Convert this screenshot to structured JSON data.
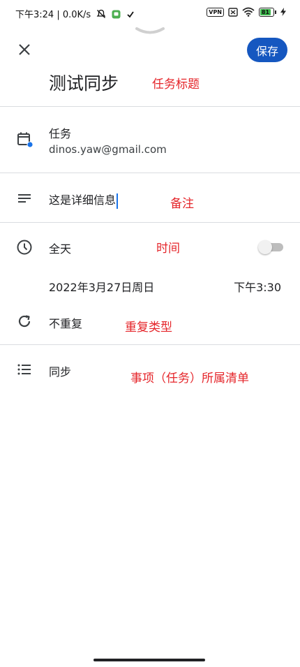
{
  "status_bar": {
    "left_text": "下午3:24 | 0.0K/s",
    "vpn": "VPN",
    "battery": "81"
  },
  "header": {
    "close_icon": "close-icon",
    "save_label": "保存"
  },
  "title": {
    "text": "测试同步",
    "annotation": "任务标题"
  },
  "account": {
    "icon": "calendar-icon",
    "accent_color": "#1a73e8",
    "label": "任务",
    "email": "dinos.yaw@gmail.com"
  },
  "notes": {
    "icon": "notes-icon",
    "value": "这是详细信息",
    "annotation": "备注"
  },
  "time": {
    "icon": "clock-icon",
    "all_day_label": "全天",
    "annotation": "时间",
    "all_day_enabled": false,
    "date": "2022年3月27日周日",
    "clock_time": "下午3:30"
  },
  "repeat": {
    "icon": "repeat-icon",
    "label": "不重复",
    "annotation": "重复类型"
  },
  "list": {
    "icon": "list-icon",
    "label": "同步",
    "annotation": "事项（任务）所属清单"
  },
  "colors": {
    "primary": "#1557c0",
    "annotation": "#e5252a"
  }
}
